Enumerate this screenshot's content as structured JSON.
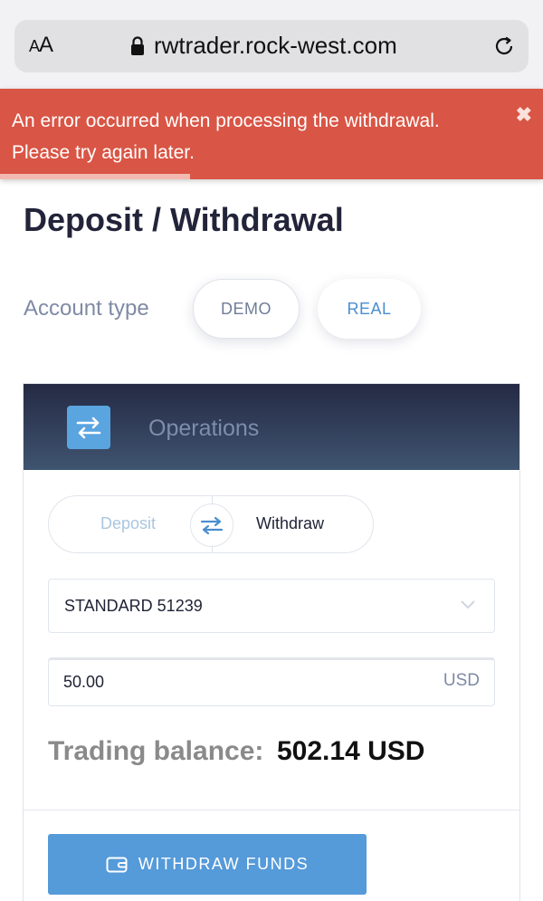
{
  "browser": {
    "text_size_label_small": "A",
    "text_size_label_large": "A",
    "url": "rwtrader.rock-west.com"
  },
  "banner": {
    "message_line1": "An error occurred when processing the withdrawal.",
    "message_line2": "Please try again later.",
    "close_icon": "close-icon",
    "progress": 0.35,
    "color": "#d95545"
  },
  "page": {
    "title": "Deposit / Withdrawal"
  },
  "account_type": {
    "label": "Account type",
    "options": [
      "DEMO",
      "REAL"
    ],
    "selected": "REAL"
  },
  "operations": {
    "title": "Operations",
    "icon": "swap-arrows-icon",
    "toggle": {
      "deposit_label": "Deposit",
      "withdraw_label": "Withdraw",
      "selected": "Withdraw"
    },
    "account_select": {
      "value": "STANDARD 51239"
    },
    "amount": {
      "value": "50.00",
      "currency": "USD"
    },
    "balance": {
      "label": "Trading balance:",
      "value": "502.14 USD"
    },
    "submit_label": "WITHDRAW FUNDS",
    "accent_color": "#559ad9"
  }
}
